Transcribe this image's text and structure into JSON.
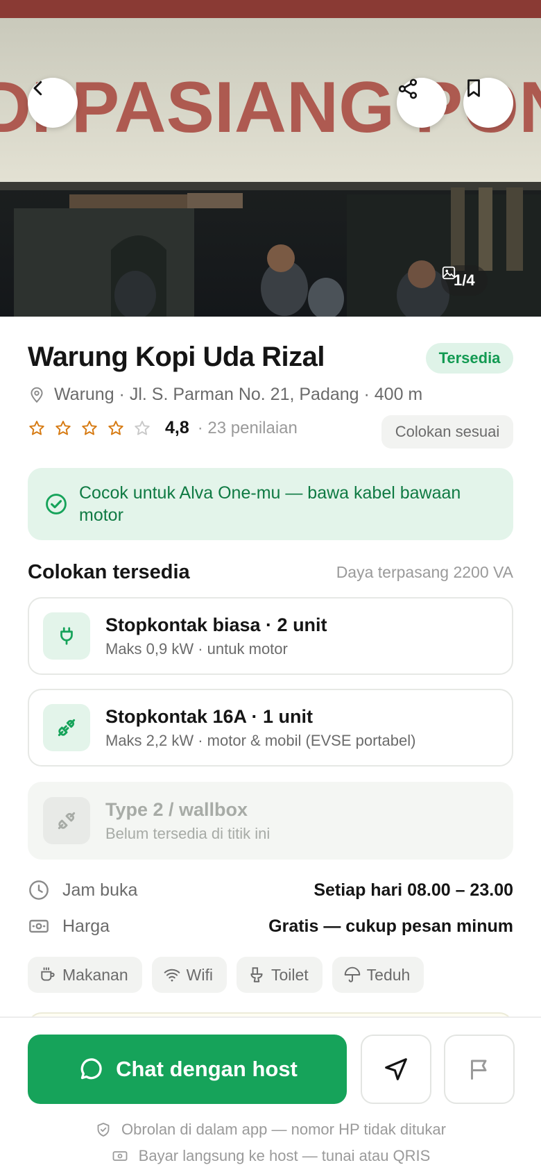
{
  "hero": {
    "banner_text": "DI PASIANG PONTIANAK",
    "photo_counter": "1/4",
    "icons": {
      "back": "chevron-left-icon",
      "share": "share-icon",
      "bookmark": "bookmark-icon",
      "gallery": "image-icon"
    }
  },
  "place": {
    "name": "Warung Kopi Uda Rizal",
    "status": "Tersedia",
    "address": "Warung · Jl. S. Parman No. 21, Padang · 400 m",
    "rating": "4,8",
    "rating_stars": 4,
    "rating_max": 5,
    "review_count": "· 23 penilaian",
    "plug_chip": "Colokan sesuai"
  },
  "match": {
    "text": "Cocok untuk Alva One-mu — bawa kabel bawaan motor"
  },
  "sockets": {
    "title": "Colokan tersedia",
    "meta": "Daya terpasang 2200 VA",
    "items": [
      {
        "name": "Stopkontak biasa · 2 unit",
        "desc": "Maks 0,9 kW · untuk motor",
        "icon": "plug-icon",
        "available": true
      },
      {
        "name": "Stopkontak 16A · 1 unit",
        "desc": "Maks 2,2 kW · motor & mobil (EVSE portabel)",
        "icon": "charging-plug-icon",
        "available": true
      },
      {
        "name": "Type 2 / wallbox",
        "desc": "Belum tersedia di titik ini",
        "icon": "plug-disconnected-icon",
        "available": false
      }
    ]
  },
  "info": {
    "hours_label": "Jam buka",
    "hours_value": "Setiap hari 08.00 – 23.00",
    "price_label": "Harga",
    "price_value": "Gratis — cukup pesan minum"
  },
  "amenities": [
    {
      "label": "Makanan",
      "icon": "coffee-cup-icon"
    },
    {
      "label": "Wifi",
      "icon": "wifi-icon"
    },
    {
      "label": "Toilet",
      "icon": "toilet-icon"
    },
    {
      "label": "Teduh",
      "icon": "umbrella-icon"
    }
  ],
  "actions": {
    "chat_label": "Chat dengan host",
    "note_privacy": "Obrolan di dalam app — nomor HP tidak ditukar",
    "note_payment": "Bayar langsung ke host — tunai atau QRIS"
  },
  "colors": {
    "brand": "#16a35a",
    "brand_dark": "#0f7a43",
    "brand_tint": "#e3f4ea",
    "star": "#d67a12",
    "text_muted": "#6b6b6b"
  }
}
